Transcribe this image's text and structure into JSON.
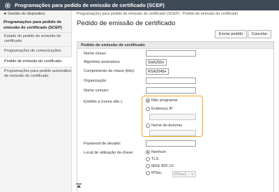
{
  "header": {
    "title": "Programações para pedido de emissão de certificado (SCEP)",
    "icon": "gear-icon"
  },
  "sidebar": {
    "back_label": "◄ Gestão do dispositivo",
    "section_title": "Programações para pedido de emissão de certificado (SCEP)",
    "items": [
      {
        "label": "Estado do pedido de emissão de certificado"
      },
      {
        "label": "Programações de comunicações"
      },
      {
        "label": "Pedido de emissão de certificado"
      },
      {
        "label": "Programações para pedido automático de emissão de certificado"
      }
    ]
  },
  "main": {
    "breadcrumb": "Programações para pedido de emissão de certificado (SCEP) : Pedido de emissão de certificado",
    "title": "Pedido de emissão de certificado",
    "send_label": "Enviar pedido",
    "cancel_label": "Cancelar"
  },
  "form": {
    "section_title": "Pedido de emissão de certificado",
    "key_name_label": "Nome chave:",
    "signature_label": "Algoritmo assinatura:",
    "signature_value": "SHA256",
    "key_length_label": "Comprimento de chave (bits):",
    "key_length_value": "RSA2048",
    "org_label": "Organização:",
    "common_name_label": "Nome comum:",
    "issued_to_label": "Emitido a (nome altn.):",
    "issued_options": [
      "Não programar",
      "Endereço IP",
      "Nome do domínio"
    ],
    "password_label": "Password de desafio:",
    "key_usage_label": "Local de utilização da chave:",
    "usage_options": [
      "Nenhum",
      "TLS",
      "IEEE 802.1X",
      "IPSec"
    ],
    "ipsec_select": "IPSec1"
  },
  "colors": {
    "header_bg": "#3f4a57",
    "highlight": "#f0a520"
  }
}
